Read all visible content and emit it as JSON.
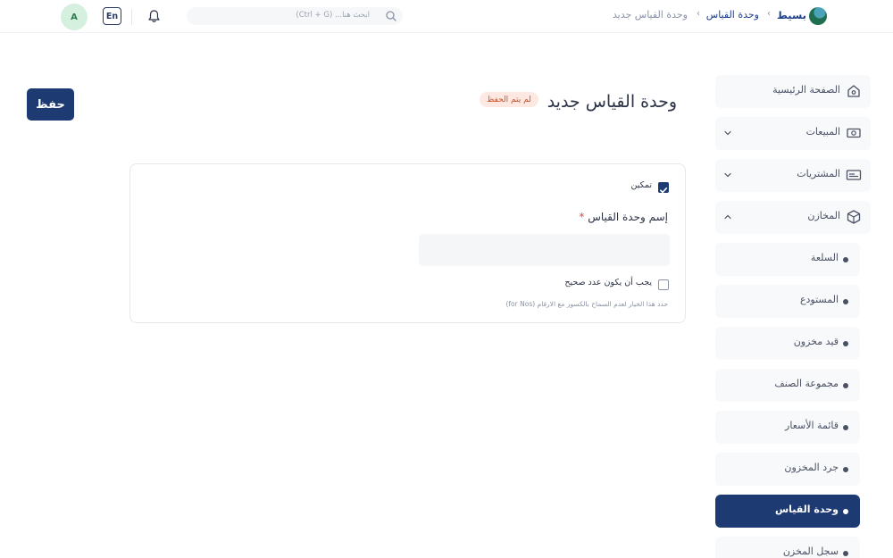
{
  "header": {
    "brand": "بسيط",
    "breadcrumb": [
      "وحدة القياس",
      "وحدة القياس جديد"
    ],
    "search_placeholder": "ابحث هنا... (Ctrl + G)",
    "lang_label": "En",
    "avatar_initial": "A"
  },
  "sidebar": {
    "main_items": [
      {
        "label": "الصفحة الرئيسية",
        "icon": "home-icon"
      },
      {
        "label": "المبيعات",
        "icon": "cash-icon"
      },
      {
        "label": "المشتريات",
        "icon": "ticket-icon"
      },
      {
        "label": "المخازن",
        "icon": "box-icon"
      }
    ],
    "sub_items": [
      {
        "label": "السلعة"
      },
      {
        "label": "المستودع"
      },
      {
        "label": "قيد مخزون"
      },
      {
        "label": "مجموعة الصنف"
      },
      {
        "label": "قائمة الأسعار"
      },
      {
        "label": "جرد المخزون"
      },
      {
        "label": "وحدة القياس"
      },
      {
        "label": "سجل المخزن"
      }
    ]
  },
  "page": {
    "title": "وحدة القياس جديد",
    "status_badge": "لم يتم الحفظ",
    "save_label": "حفظ"
  },
  "form": {
    "enable_label": "تمكين",
    "enable_checked": true,
    "name_label": "إسم وحدة القياس",
    "name_required_mark": "*",
    "name_value": "",
    "integer_label": "يجب أن يكون عدد صحيح",
    "integer_checked": false,
    "integer_help": "حدد هذا الخيار لعدم السماح بالكسور مع الارقام (for Nos)"
  },
  "colors": {
    "primary": "#1e3a73",
    "badge_bg": "#fde9e2",
    "badge_text": "#c5522b",
    "required": "#e0493a"
  }
}
